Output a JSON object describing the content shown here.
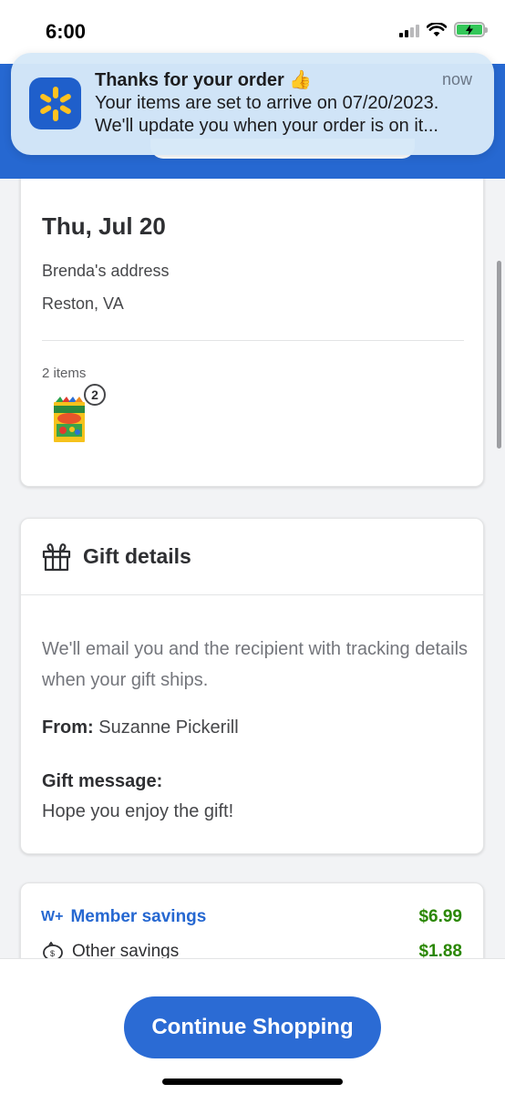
{
  "status_bar": {
    "time": "6:00"
  },
  "notification": {
    "title": "Thanks for your order 👍",
    "time": "now",
    "body_line1": "Your items are set to arrive on 07/20/2023.",
    "body_line2": "We'll update you when your order is on it...",
    "app_icon": "walmart-spark-icon"
  },
  "delivery": {
    "date": "Thu, Jul 20",
    "address_name": "Brenda's address",
    "address_city": "Reston, VA",
    "items_count": "2 items",
    "item_quantity": "2"
  },
  "gift": {
    "title": "Gift details",
    "icon": "gift-icon",
    "description": "We'll email you and the recipient with tracking details when your gift ships.",
    "from_label": "From:",
    "from_name": "Suzanne Pickerill",
    "message_label": "Gift message:",
    "message": "Hope you enjoy the gift!"
  },
  "savings": {
    "member_badge": "W+",
    "member_label": "Member savings",
    "member_amount": "$6.99",
    "other_label": "Other savings",
    "other_amount": "$1.88"
  },
  "footer": {
    "cta_label": "Continue Shopping"
  },
  "colors": {
    "brand_blue": "#2668d1",
    "savings_green": "#2a8703",
    "spark_yellow": "#ffc220"
  }
}
